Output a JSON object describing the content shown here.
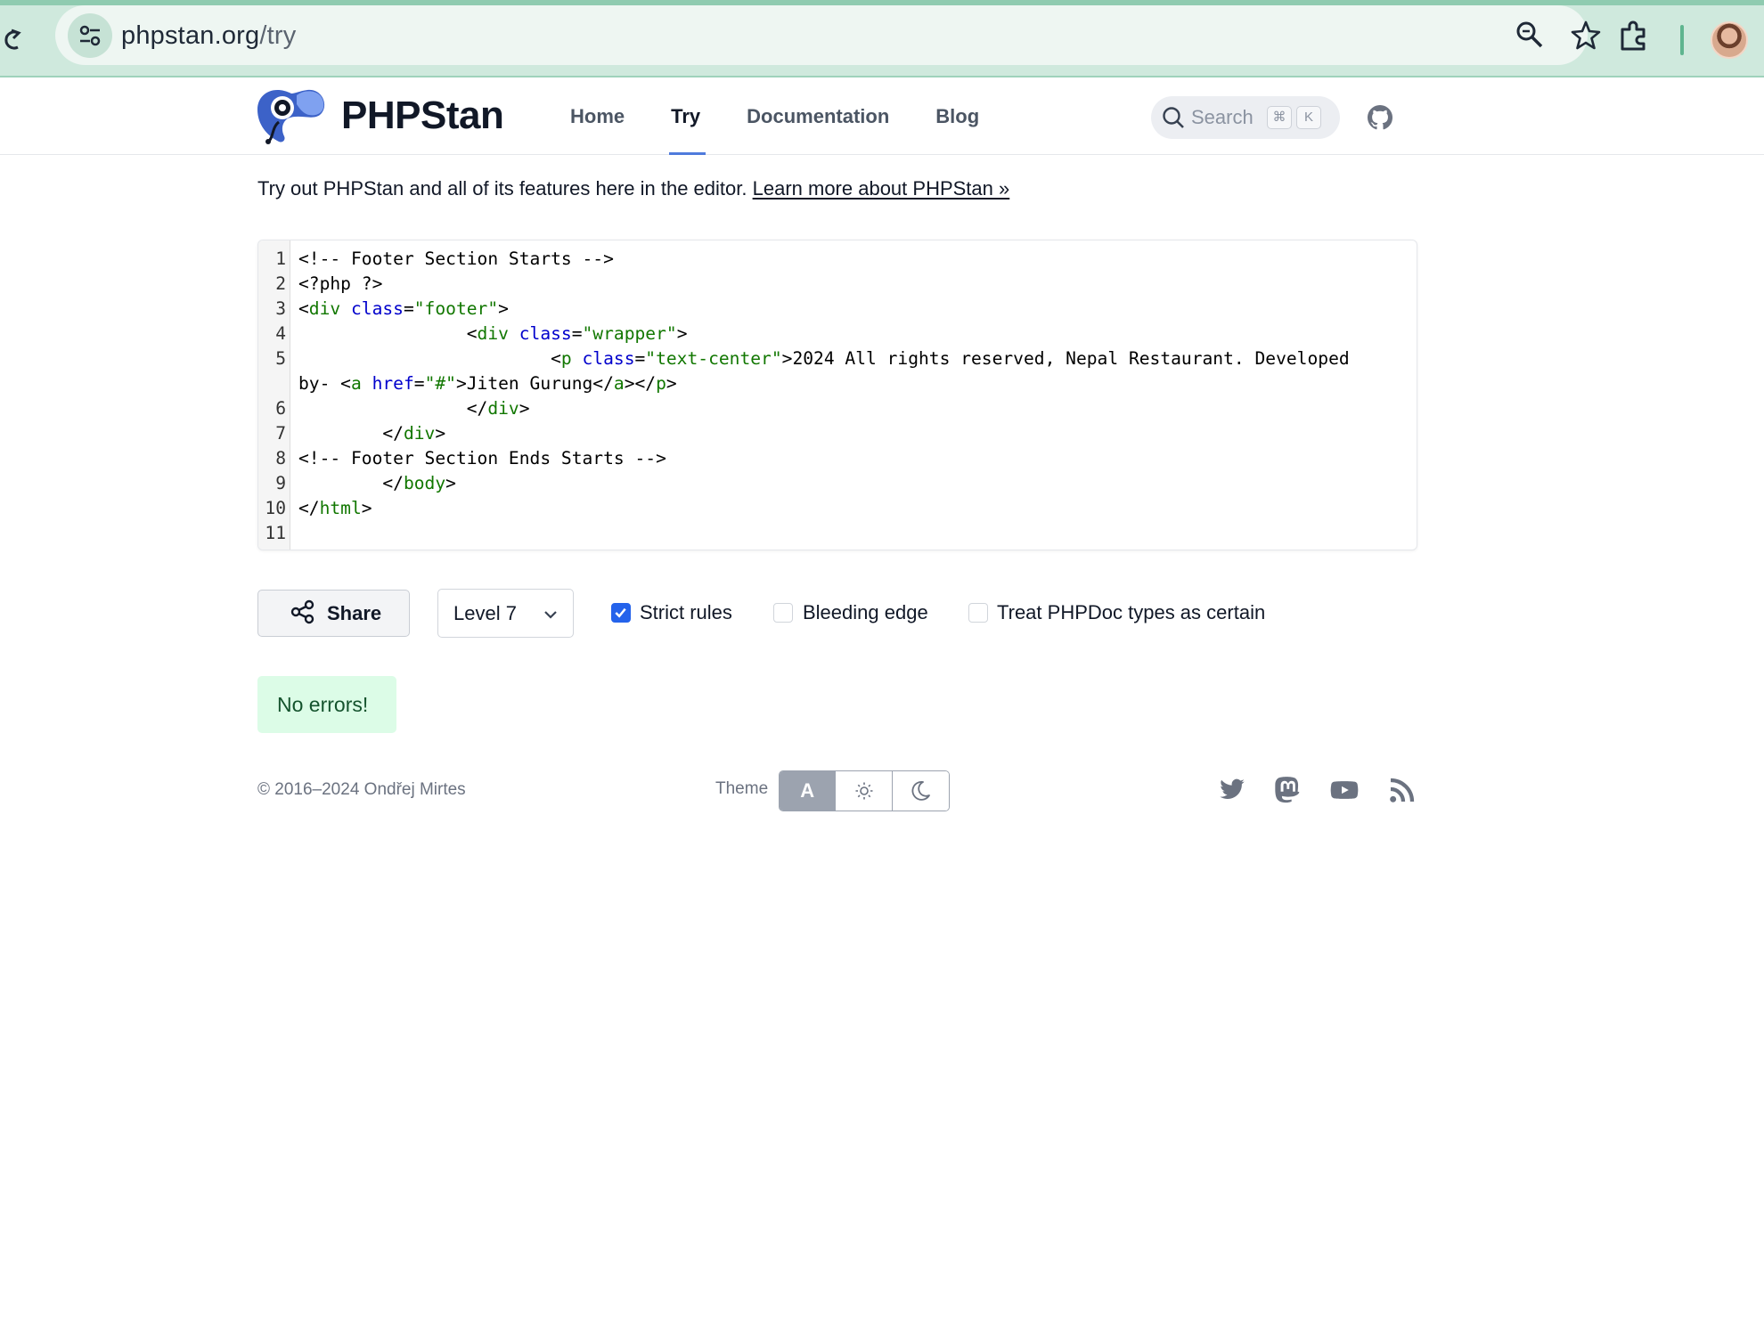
{
  "browser": {
    "url_host": "phpstan.org",
    "url_path": "/try"
  },
  "header": {
    "logo_text": "PHPStan",
    "nav": [
      {
        "label": "Home"
      },
      {
        "label": "Try",
        "active": true
      },
      {
        "label": "Documentation"
      },
      {
        "label": "Blog"
      }
    ],
    "search": {
      "placeholder": "Search",
      "shortcut_mod": "⌘",
      "shortcut_key": "K"
    }
  },
  "intro": {
    "text": "Try out PHPStan and all of its features here in the editor. ",
    "link": "Learn more about PHPStan »"
  },
  "editor": {
    "line_numbers": [
      "1",
      "2",
      "3",
      "4",
      "5",
      "6",
      "7",
      "8",
      "9",
      "10",
      "11"
    ]
  },
  "controls": {
    "share_label": "Share",
    "level_value": "Level 7",
    "options": [
      {
        "label": "Strict rules",
        "checked": true
      },
      {
        "label": "Bleeding edge",
        "checked": false
      },
      {
        "label": "Treat PHPDoc types as certain",
        "checked": false
      }
    ]
  },
  "result": {
    "text": "No errors!"
  },
  "footer": {
    "copyright": "© 2016–2024 Ondřej Mirtes",
    "theme_label": "Theme",
    "theme_auto": "A",
    "social": [
      "twitter-icon",
      "mastodon-icon",
      "youtube-icon",
      "rss-icon"
    ]
  },
  "colors": {
    "accent": "#4f7bdc",
    "checkbox": "#2563eb",
    "success_bg": "#dcfce7",
    "success_text": "#14532d",
    "chrome": "#cfe9dd"
  }
}
